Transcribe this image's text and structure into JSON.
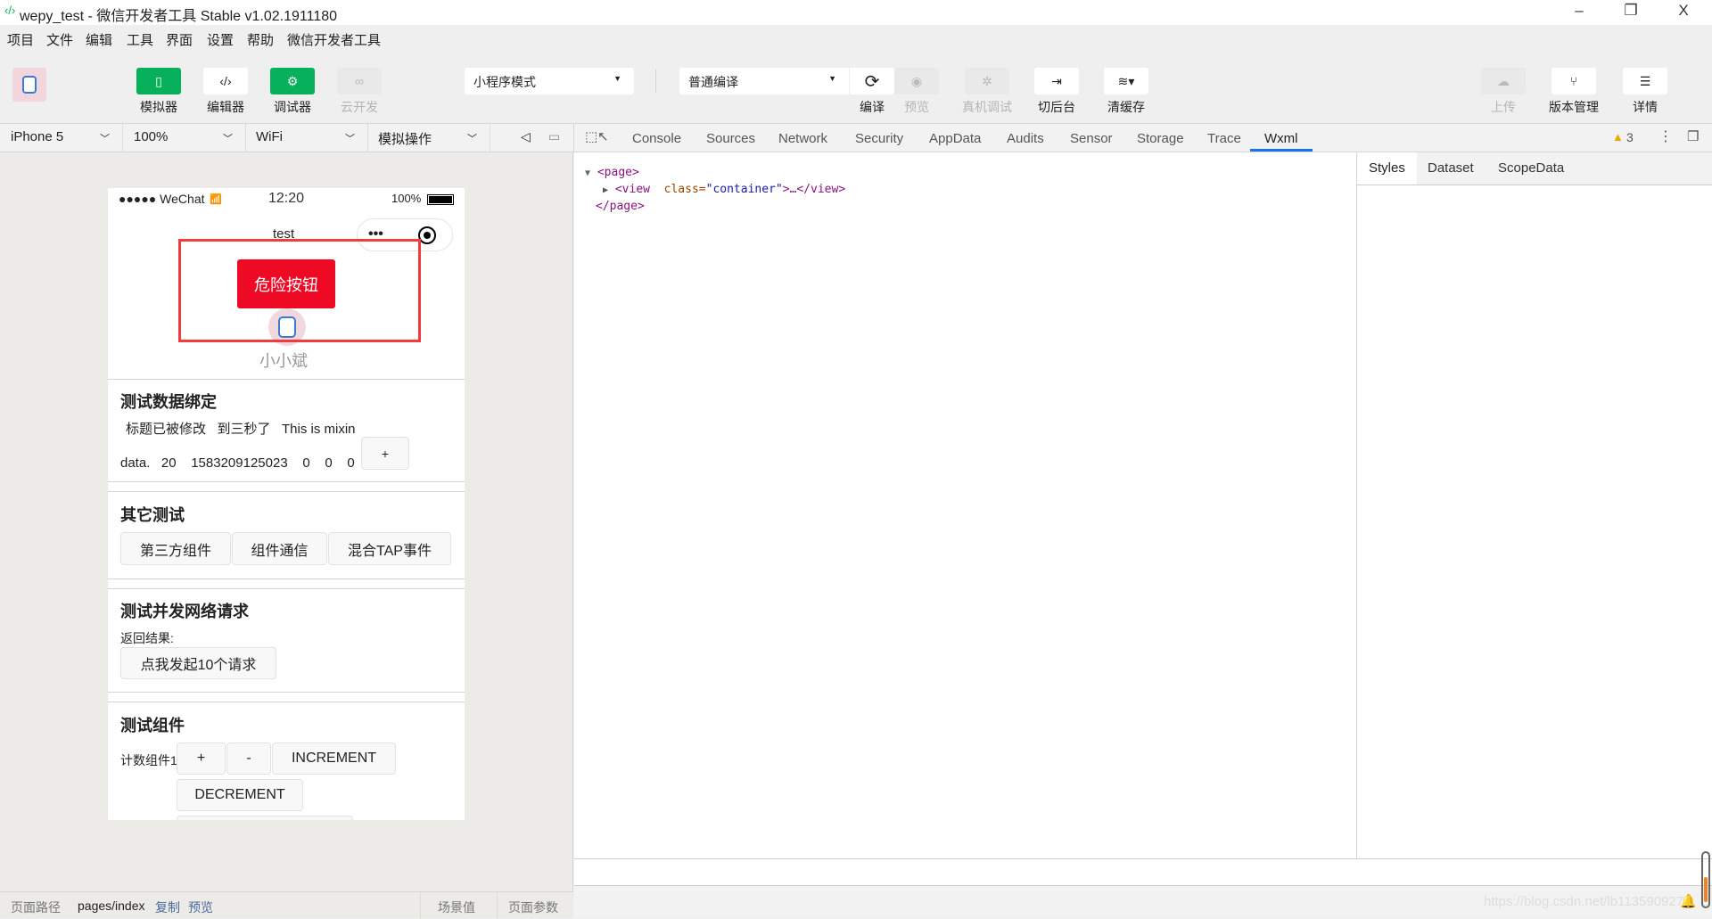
{
  "window": {
    "title": "wepy_test - 微信开发者工具 Stable v1.02.1911180",
    "minimize": "–",
    "restore": "❐",
    "close": "X"
  },
  "menu": [
    "项目",
    "文件",
    "编辑",
    "工具",
    "界面",
    "设置",
    "帮助",
    "微信开发者工具"
  ],
  "toolbar": {
    "simulator": "模拟器",
    "editor": "编辑器",
    "debugger": "调试器",
    "cloud": "云开发",
    "mode_select": "小程序模式",
    "compile_select": "普通编译",
    "compile": "编译",
    "preview": "预览",
    "remote_debug": "真机调试",
    "background": "切后台",
    "clear_cache": "清缓存",
    "upload": "上传",
    "version": "版本管理",
    "details": "详情"
  },
  "device_bar": {
    "device": "iPhone 5",
    "zoom": "100%",
    "network": "WiFi",
    "sim_ops": "模拟操作"
  },
  "devtools": {
    "tabs": [
      "Console",
      "Sources",
      "Network",
      "Security",
      "AppData",
      "Audits",
      "Sensor",
      "Storage",
      "Trace",
      "Wxml"
    ],
    "active_tab": "Wxml",
    "warnings": "3",
    "wxml": {
      "open": "<page>",
      "view_tag": "<view",
      "attr": "class=",
      "attr_val": "\"container\"",
      "ellipsis": ">…</view>",
      "close": "</page>"
    },
    "side_tabs": [
      "Styles",
      "Dataset",
      "ScopeData"
    ],
    "watermark": "https://blog.csdn.net/lb1135909273"
  },
  "phone": {
    "status": {
      "signal": "●●●●● WeChat",
      "time": "12:20",
      "battery": "100%"
    },
    "nav_title": "test",
    "capsule_more": "•••",
    "danger_button": "危险按钮",
    "username": "小小斌",
    "s1": {
      "title": "测试数据绑定",
      "line1": "标题已被修改   到三秒了   This is mixin",
      "line2": "data.   20    1583209125023    0    0    0",
      "plus": "+"
    },
    "s2": {
      "title": "其它测试",
      "buttons": [
        "第三方组件",
        "组件通信",
        "混合TAP事件"
      ]
    },
    "s3": {
      "title": "测试并发网络请求",
      "result_label": "返回结果:",
      "button": "点我发起10个请求"
    },
    "s4": {
      "title": "测试组件",
      "label": "计数组件1",
      "plus": "+",
      "minus": "-",
      "inc": "INCREMENT",
      "dec": "DECREMENT"
    }
  },
  "footer": {
    "path_label": "页面路径",
    "path": "pages/index",
    "copy": "复制",
    "preview": "预览",
    "scene": "场景值",
    "params": "页面参数"
  },
  "colors": {
    "accent": "#07b05a",
    "danger": "#ee0a24",
    "tab_underline": "#1a73e8",
    "highlight_box": "#f03c3c"
  }
}
